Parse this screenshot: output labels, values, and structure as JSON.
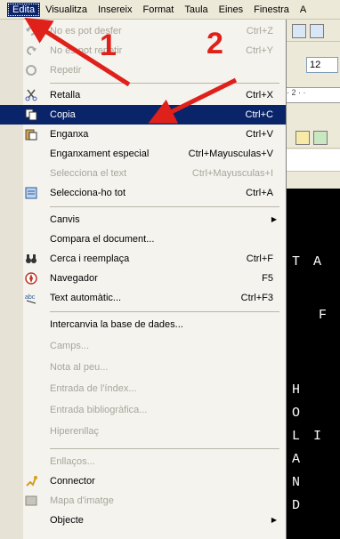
{
  "menubar": {
    "items": [
      "Edita",
      "Visualitza",
      "Insereix",
      "Format",
      "Taula",
      "Eines",
      "Finestra",
      "A"
    ]
  },
  "toolbar": {
    "font_size": "12",
    "ruler": "· 2 · ·"
  },
  "menu": {
    "items": [
      {
        "label": "No es pot desfer",
        "shortcut": "Ctrl+Z",
        "disabled": true,
        "icon": "undo-icon"
      },
      {
        "label": "No es pot repetir",
        "shortcut": "Ctrl+Y",
        "disabled": true,
        "icon": "redo-icon"
      },
      {
        "label": "Repetir",
        "shortcut": "",
        "disabled": true,
        "icon": "repeat-icon"
      },
      {
        "label": "Retalla",
        "shortcut": "Ctrl+X",
        "disabled": false,
        "icon": "scissors-icon"
      },
      {
        "label": "Copia",
        "shortcut": "Ctrl+C",
        "disabled": false,
        "icon": "copy-icon",
        "selected": true
      },
      {
        "label": "Enganxa",
        "shortcut": "Ctrl+V",
        "disabled": false,
        "icon": "paste-icon"
      },
      {
        "label": "Enganxament especial",
        "shortcut": "Ctrl+Mayusculas+V",
        "disabled": false
      },
      {
        "label": "Selecciona el text",
        "shortcut": "Ctrl+Mayusculas+I",
        "disabled": true
      },
      {
        "label": "Selecciona-ho tot",
        "shortcut": "Ctrl+A",
        "disabled": false,
        "icon": "select-all-icon"
      },
      {
        "label": "Canvis",
        "shortcut": "",
        "disabled": false,
        "submenu": true
      },
      {
        "label": "Compara el document...",
        "shortcut": "",
        "disabled": false
      },
      {
        "label": "Cerca i reemplaça",
        "shortcut": "Ctrl+F",
        "disabled": false,
        "icon": "binoculars-icon"
      },
      {
        "label": "Navegador",
        "shortcut": "F5",
        "disabled": false,
        "icon": "navigator-icon"
      },
      {
        "label": "Text automàtic...",
        "shortcut": "Ctrl+F3",
        "disabled": false,
        "icon": "autotext-icon"
      },
      {
        "label": "Intercanvia la base de dades...",
        "shortcut": "",
        "disabled": false
      },
      {
        "label": "Camps...",
        "shortcut": "",
        "disabled": true
      },
      {
        "label": "Nota al peu...",
        "shortcut": "",
        "disabled": true
      },
      {
        "label": "Entrada de l'índex...",
        "shortcut": "",
        "disabled": true
      },
      {
        "label": "Entrada bibliogràfica...",
        "shortcut": "",
        "disabled": true
      },
      {
        "label": "Hiperenllaç",
        "shortcut": "",
        "disabled": true
      },
      {
        "label": "Enllaços...",
        "shortcut": "",
        "disabled": true
      },
      {
        "label": "Connector",
        "shortcut": "",
        "disabled": false,
        "icon": "plugin-icon"
      },
      {
        "label": "Mapa d'imatge",
        "shortcut": "",
        "disabled": true,
        "icon": "imagemap-icon"
      },
      {
        "label": "Objecte",
        "shortcut": "",
        "disabled": false,
        "submenu": true
      }
    ]
  },
  "annotations": {
    "one": "1",
    "two": "2"
  },
  "doc_letters": [
    "T",
    "A",
    "F",
    "H",
    "O",
    "L",
    "I",
    "A",
    "N",
    "D"
  ],
  "colors": {
    "highlight": "#0a246a",
    "arrow": "#e0201a"
  }
}
